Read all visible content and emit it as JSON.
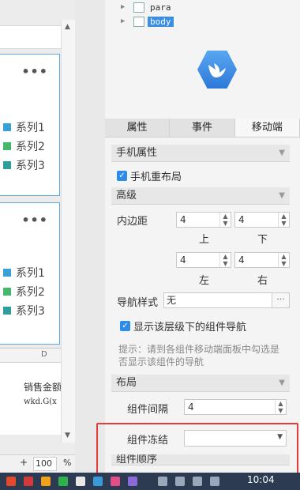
{
  "canvas": {
    "panel1": {
      "legend": [
        "系列1",
        "系列2",
        "系列3"
      ]
    },
    "panel2": {
      "legend": [
        "系列1",
        "系列2",
        "系列3"
      ]
    },
    "grid": {
      "col_letter": "D",
      "header_cell": "销售金额",
      "formula_cell": "wkd.G(x"
    },
    "zoom": {
      "plus": "+",
      "value": "100",
      "unit": "%"
    }
  },
  "tree": {
    "nodes": [
      "para",
      "body"
    ]
  },
  "tabs": [
    "属性",
    "事件",
    "移动端"
  ],
  "sections": {
    "phone": {
      "title": "手机属性",
      "checkbox": "手机重布局"
    },
    "advanced": {
      "title": "高级",
      "padding_label": "内边距",
      "top": "4",
      "bottom": "4",
      "left": "4",
      "right": "4",
      "top_label": "上",
      "bottom_label": "下",
      "left_label": "左",
      "right_label": "右",
      "nav_style_label": "导航样式",
      "nav_style_value": "无",
      "nav_more": "···",
      "show_nav_checkbox": "显示该层级下的组件导航",
      "hint": "提示：请到各组件移动端面板中勾选是否显示该组件的导航"
    },
    "layout": {
      "title": "布局",
      "gap_label": "组件间隔",
      "gap_value": "4",
      "freeze_label": "组件冻结",
      "order_label": "组件顺序"
    }
  },
  "taskbar": {
    "time": "10:04"
  },
  "colors": {
    "accent": "#2d8ce8",
    "highlight_box": "#e53b3b",
    "series": [
      "#3aa0d8",
      "#45b86b",
      "#2f9d9a"
    ]
  }
}
